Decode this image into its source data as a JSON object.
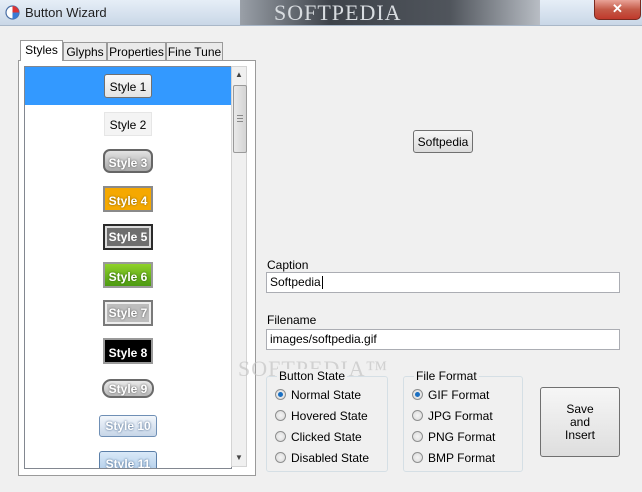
{
  "window": {
    "title": "Button Wizard",
    "watermark": "SOFTPEDIA",
    "close_icon": "✕"
  },
  "tabs": [
    {
      "label": "Styles",
      "active": true
    },
    {
      "label": "Glyphs",
      "active": false
    },
    {
      "label": "Properties",
      "active": false
    },
    {
      "label": "Fine Tune",
      "active": false
    }
  ],
  "styles_list": {
    "selected_index": 0,
    "items": [
      {
        "label": "Style 1"
      },
      {
        "label": "Style 2"
      },
      {
        "label": "Style 3"
      },
      {
        "label": "Style 4"
      },
      {
        "label": "Style 5"
      },
      {
        "label": "Style 6"
      },
      {
        "label": "Style 7"
      },
      {
        "label": "Style 8"
      },
      {
        "label": "Style 9"
      },
      {
        "label": "Style 10"
      },
      {
        "label": "Style 11"
      }
    ]
  },
  "preview": {
    "label": "Softpedia"
  },
  "caption": {
    "label": "Caption",
    "value": "Softpedia"
  },
  "filename": {
    "label": "Filename",
    "value": "images/softpedia.gif"
  },
  "button_state": {
    "label": "Button State",
    "options": [
      {
        "label": "Normal State",
        "selected": true
      },
      {
        "label": "Hovered State",
        "selected": false
      },
      {
        "label": "Clicked State",
        "selected": false
      },
      {
        "label": "Disabled State",
        "selected": false
      }
    ]
  },
  "file_format": {
    "label": "File Format",
    "options": [
      {
        "label": "GIF Format",
        "selected": true
      },
      {
        "label": "JPG Format",
        "selected": false
      },
      {
        "label": "PNG Format",
        "selected": false
      },
      {
        "label": "BMP Format",
        "selected": false
      }
    ]
  },
  "save_button": {
    "line1": "Save",
    "line2": "and",
    "line3": "Insert"
  },
  "watermark_center": "SOFTPEDIA™",
  "colors": {
    "selection": "#3399ff",
    "titlebar": "#c9d7e7",
    "close": "#c0392b"
  }
}
